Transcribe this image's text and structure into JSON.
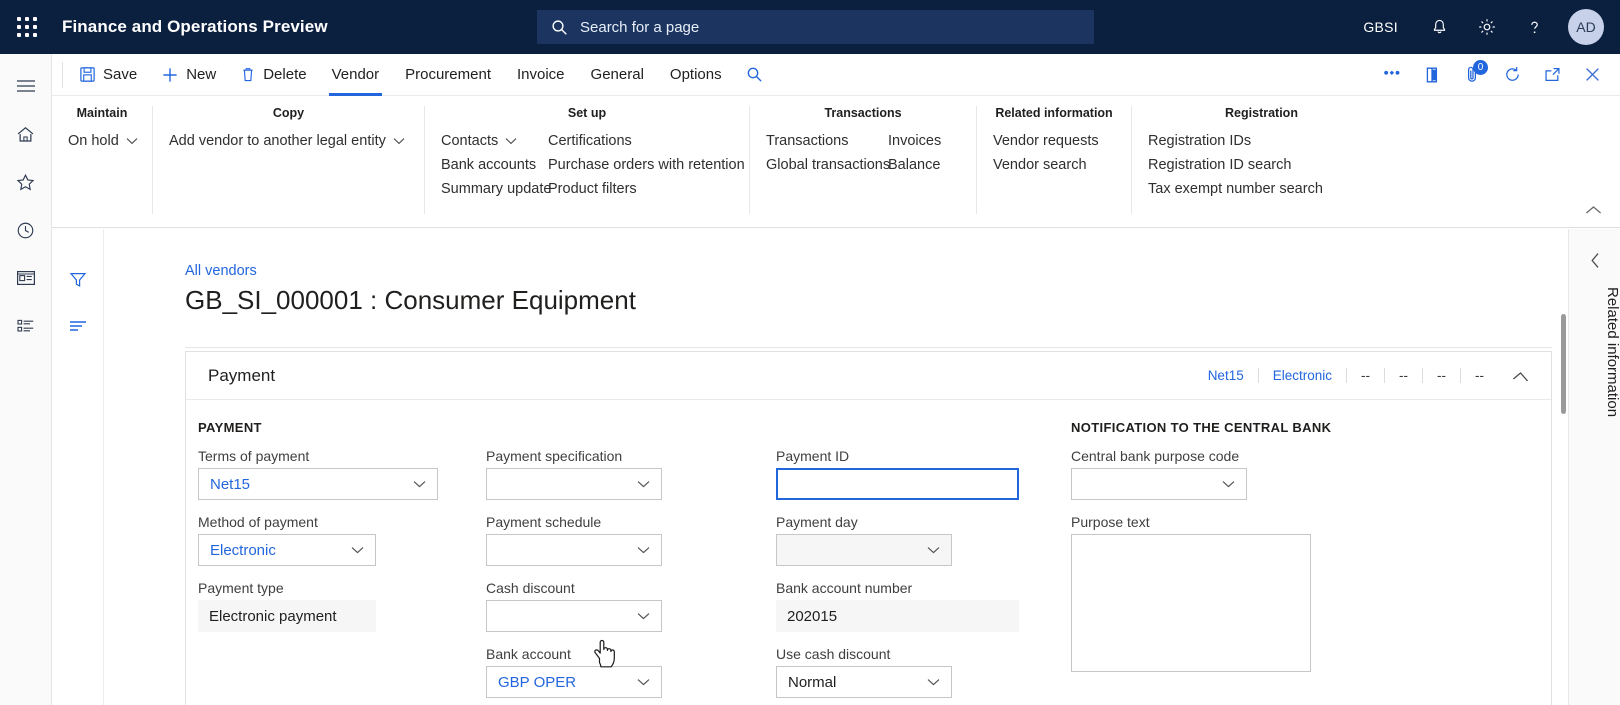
{
  "topbar": {
    "waffle_icon": "waffle-grid-icon",
    "app_title": "Finance and Operations Preview",
    "search_placeholder": "Search for a page",
    "search_icon": "search-icon",
    "company": "GBSI",
    "notifications_icon": "bell-icon",
    "settings_icon": "gear-icon",
    "help_icon": "question-icon",
    "avatar_initials": "AD"
  },
  "rail": {
    "items": [
      {
        "name": "hamburger-menu",
        "icon": "hamburger-icon"
      },
      {
        "name": "home",
        "icon": "home-icon"
      },
      {
        "name": "favorites",
        "icon": "star-icon"
      },
      {
        "name": "recent",
        "icon": "clock-icon"
      },
      {
        "name": "workspaces",
        "icon": "workspace-icon"
      },
      {
        "name": "modules",
        "icon": "list-icon"
      }
    ]
  },
  "actionpane": {
    "buttons": [
      {
        "label": "Save",
        "icon": "save-icon"
      },
      {
        "label": "New",
        "icon": "plus-icon"
      },
      {
        "label": "Delete",
        "icon": "trash-icon"
      }
    ],
    "tabs": [
      {
        "label": "Vendor",
        "active": true
      },
      {
        "label": "Procurement",
        "active": false
      },
      {
        "label": "Invoice",
        "active": false
      },
      {
        "label": "General",
        "active": false
      },
      {
        "label": "Options",
        "active": false
      }
    ],
    "find_icon": "search-icon",
    "right_icons": [
      {
        "name": "power-bi-icon",
        "badge": null
      },
      {
        "name": "office-icon",
        "badge": null
      },
      {
        "name": "attachments-icon",
        "badge": "0"
      },
      {
        "name": "refresh-icon",
        "badge": null
      },
      {
        "name": "open-in-new-window-icon",
        "badge": null
      },
      {
        "name": "close-icon",
        "badge": null
      }
    ]
  },
  "ribbon": {
    "collapse_icon": "chevron-up-icon",
    "groups": [
      {
        "title": "Maintain",
        "columns": [
          [
            {
              "label": "On hold",
              "dropdown": true
            }
          ]
        ]
      },
      {
        "title": "Copy",
        "columns": [
          [
            {
              "label": "Add vendor to another legal entity",
              "dropdown": true
            }
          ]
        ]
      },
      {
        "title": "Set up",
        "columns": [
          [
            {
              "label": "Contacts",
              "dropdown": true
            },
            {
              "label": "Bank accounts",
              "dropdown": false
            },
            {
              "label": "Summary update",
              "dropdown": false
            }
          ],
          [
            {
              "label": "Certifications",
              "dropdown": false
            },
            {
              "label": "Purchase orders with retention",
              "dropdown": false
            },
            {
              "label": "Product filters",
              "dropdown": false
            }
          ]
        ]
      },
      {
        "title": "Transactions",
        "columns": [
          [
            {
              "label": "Transactions",
              "dropdown": false
            },
            {
              "label": "Global transactions",
              "dropdown": false
            }
          ],
          [
            {
              "label": "Invoices",
              "dropdown": false
            },
            {
              "label": "Balance",
              "dropdown": false
            }
          ]
        ]
      },
      {
        "title": "Related information",
        "columns": [
          [
            {
              "label": "Vendor requests",
              "dropdown": false
            },
            {
              "label": "Vendor search",
              "dropdown": false
            }
          ]
        ]
      },
      {
        "title": "Registration",
        "columns": [
          [
            {
              "label": "Registration IDs",
              "dropdown": false
            },
            {
              "label": "Registration ID search",
              "dropdown": false
            },
            {
              "label": "Tax exempt number search",
              "dropdown": false
            }
          ]
        ]
      }
    ]
  },
  "filter_rail": {
    "items": [
      {
        "name": "filter",
        "icon": "filter-icon"
      },
      {
        "name": "show-list",
        "icon": "lines-icon"
      }
    ]
  },
  "page": {
    "breadcrumb": "All vendors",
    "title": "GB_SI_000001 : Consumer Equipment"
  },
  "fasttab": {
    "title": "Payment",
    "collapse_icon": "chevron-up-icon",
    "summary": [
      {
        "text": "Net15",
        "dim": false
      },
      {
        "text": "Electronic",
        "dim": false
      },
      {
        "text": "--",
        "dim": true
      },
      {
        "text": "--",
        "dim": true
      },
      {
        "text": "--",
        "dim": true
      },
      {
        "text": "--",
        "dim": true
      }
    ],
    "column1": {
      "section_title": "PAYMENT",
      "fields": [
        {
          "label": "Terms of payment",
          "value": "Net15",
          "type": "dropdown",
          "style": "link"
        },
        {
          "label": "Method of payment",
          "value": "Electronic",
          "type": "dropdown",
          "style": "link"
        },
        {
          "label": "Payment type",
          "value": "Electronic payment",
          "type": "readonly",
          "style": "flat"
        }
      ]
    },
    "column2": {
      "fields": [
        {
          "label": "Payment specification",
          "value": "",
          "type": "dropdown",
          "style": "plain"
        },
        {
          "label": "Payment schedule",
          "value": "",
          "type": "dropdown",
          "style": "plain"
        },
        {
          "label": "Cash discount",
          "value": "",
          "type": "dropdown",
          "style": "plain"
        },
        {
          "label": "Bank account",
          "value": "GBP OPER",
          "type": "dropdown",
          "style": "link"
        }
      ]
    },
    "column3": {
      "fields": [
        {
          "label": "Payment ID",
          "value": "",
          "type": "text",
          "style": "focused"
        },
        {
          "label": "Payment day",
          "value": "",
          "type": "dropdown",
          "style": "shaded"
        },
        {
          "label": "Bank account number",
          "value": "202015",
          "type": "readonly",
          "style": "flat"
        },
        {
          "label": "Use cash discount",
          "value": "Normal",
          "type": "dropdown",
          "style": "plain"
        }
      ]
    },
    "column4": {
      "section_title": "NOTIFICATION TO THE CENTRAL BANK",
      "fields": [
        {
          "label": "Central bank purpose code",
          "value": "",
          "type": "dropdown",
          "style": "plain"
        },
        {
          "label": "Purpose text",
          "value": "",
          "type": "textarea",
          "style": "plain"
        }
      ]
    }
  },
  "related_panel": {
    "collapse_icon": "chevron-left-icon",
    "label": "Related information"
  },
  "colors": {
    "topbar_bg": "#0b1f3f",
    "accent_link": "#2266dd",
    "search_bg": "#1b3560",
    "page_bg": "#f2f2f2",
    "avatar_bg": "#c7d2ea"
  }
}
